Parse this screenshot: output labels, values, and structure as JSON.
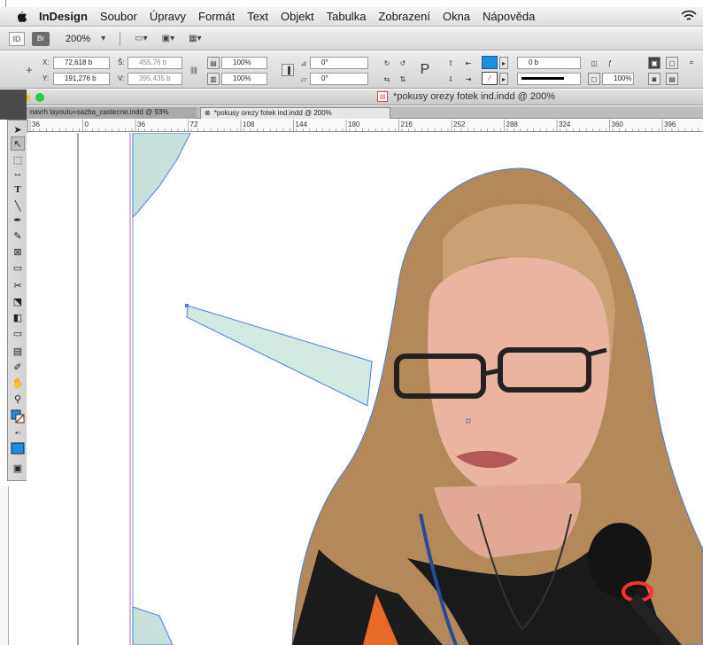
{
  "menubar": {
    "app_name": "InDesign",
    "items": [
      "Soubor",
      "Úpravy",
      "Formát",
      "Text",
      "Objekt",
      "Tabulka",
      "Zobrazení",
      "Okna",
      "Nápověda"
    ]
  },
  "appbar": {
    "logo": "ID",
    "bridge": "Br",
    "zoom": "200%"
  },
  "control": {
    "x_label": "X:",
    "x_value": "72,618 b",
    "y_label": "Y:",
    "y_value": "191,276 b",
    "w_label": "Š:",
    "w_value": "455,76 b",
    "h_label": "V:",
    "h_value": "395,435 b",
    "scale_x": "100%",
    "scale_y": "100%",
    "rotate": "0°",
    "shear": "0°",
    "stroke_weight": "0 b",
    "opacity": "100%"
  },
  "document": {
    "window_title": "*pokusy orezy fotek ind.indd @ 200%",
    "tabs": [
      {
        "label": "navrh layoutu+sazba_castecne.indd @ 93%"
      },
      {
        "label": "*pokusy orezy fotek ind.indd @ 200%"
      }
    ]
  },
  "ruler": {
    "ticks": [
      "36",
      "0",
      "36",
      "72",
      "108",
      "144",
      "180",
      "216",
      "252",
      "288",
      "324",
      "360",
      "396"
    ]
  },
  "colors": {
    "accent": "#1b8fe6",
    "selection": "#4a7ee0",
    "frame_fill": "#c8e0dc"
  },
  "tools": [
    "selection-tool-icon",
    "direct-selection-tool-icon",
    "page-tool-icon",
    "gap-tool-icon",
    "type-tool-icon",
    "line-tool-icon",
    "pen-tool-icon",
    "pencil-tool-icon",
    "rectangle-frame-tool-icon",
    "rectangle-tool-icon",
    "scissors-tool-icon",
    "free-transform-tool-icon",
    "gradient-swatch-tool-icon",
    "gradient-feather-tool-icon",
    "note-tool-icon",
    "eyedropper-tool-icon",
    "hand-tool-icon",
    "zoom-tool-icon",
    "fill-stroke-icon",
    "normal-mode-icon",
    "preview-mode-icon"
  ]
}
